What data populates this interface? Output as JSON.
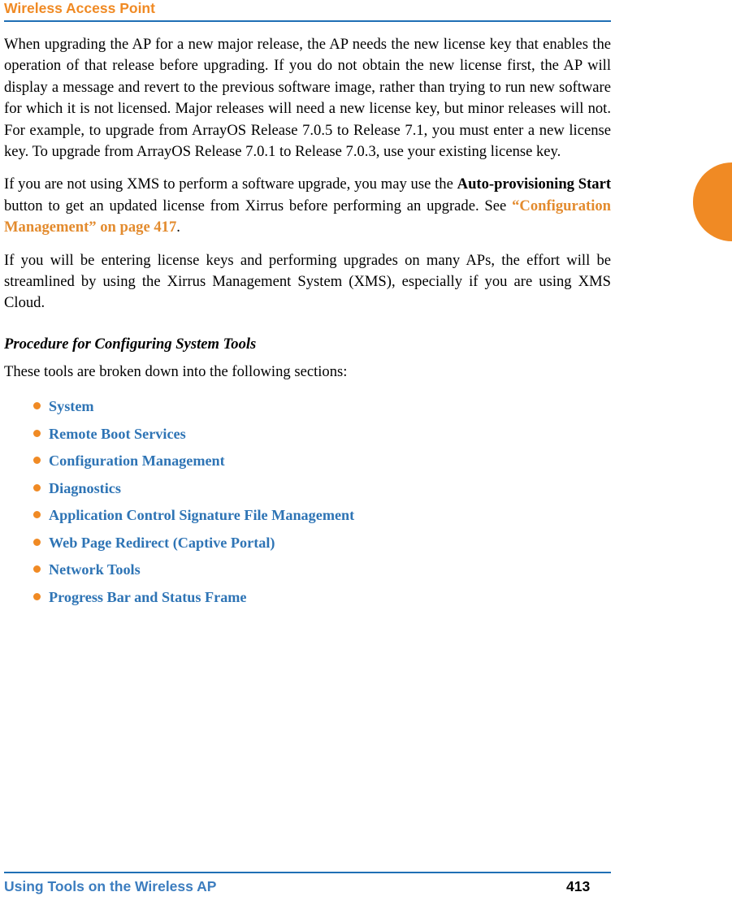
{
  "header": {
    "title": "Wireless Access Point"
  },
  "body": {
    "para1": "When upgrading the AP for a new major release, the AP needs the new license key that enables the operation of that release before upgrading. If you do not obtain the new license first, the AP will display a message and revert to the previous software image, rather than trying to run new software for which it is not licensed. Major releases will need a new license key, but minor releases will not. For example, to upgrade from ArrayOS Release 7.0.5 to Release 7.1, you must enter a new license key. To upgrade from ArrayOS Release 7.0.1 to Release 7.0.3, use your existing license key.",
    "para2_a": "If you are not using XMS to perform a software upgrade, you may use the ",
    "para2_bold": "Auto-provisioning Start",
    "para2_b": " button to get an updated license from Xirrus before performing an upgrade. See ",
    "para2_xref": "“Configuration Management” on page 417",
    "para2_c": ".",
    "para3": "If you will be entering license keys and performing upgrades on many APs, the effort will be streamlined by using the Xirrus Management System (XMS), especially if you are using XMS Cloud.",
    "subhead": "Procedure for Configuring System Tools",
    "intro": "These tools are broken down into the following sections:"
  },
  "sections": [
    {
      "label": "System"
    },
    {
      "label": "Remote Boot Services"
    },
    {
      "label": "Configuration Management"
    },
    {
      "label": "Diagnostics"
    },
    {
      "label": "Application Control Signature File Management"
    },
    {
      "label": "Web Page Redirect (Captive Portal)"
    },
    {
      "label": "Network Tools"
    },
    {
      "label": "Progress Bar and Status Frame"
    }
  ],
  "footer": {
    "left": "Using Tools on the Wireless AP",
    "page": "413"
  },
  "colors": {
    "accent_orange": "#F08A24",
    "rule_blue": "#1F6FB5",
    "link_blue": "#2E74B5",
    "xref_orange": "#E38B2E"
  }
}
